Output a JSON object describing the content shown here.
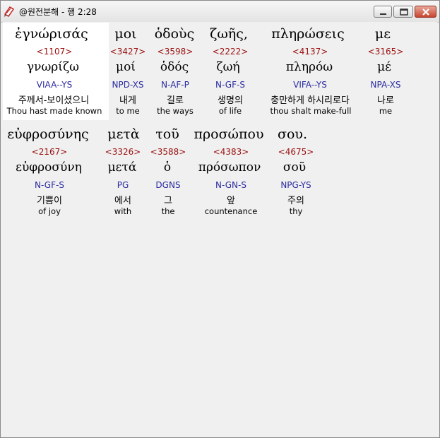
{
  "window": {
    "title": "@원전분해 - 행 2:28"
  },
  "lines": [
    {
      "words": [
        {
          "greek": "ἐγνώρισάς",
          "num": "<1107>",
          "lemma": "γνωρίζω",
          "morph": "VIAA--YS",
          "kor": "주께서-보이셨으니",
          "eng": "Thou hast made known",
          "selected": true
        },
        {
          "greek": "μοι",
          "num": "<3427>",
          "lemma": "μοί",
          "morph": "NPD-XS",
          "kor": "내게",
          "eng": "to me"
        },
        {
          "greek": "ὁδοὺς",
          "num": "<3598>",
          "lemma": "ὁδός",
          "morph": "N-AF-P",
          "kor": "길로",
          "eng": "the ways"
        },
        {
          "greek": "ζωῆς,",
          "num": "<2222>",
          "lemma": "ζωή",
          "morph": "N-GF-S",
          "kor": "생명의",
          "eng": "of life"
        },
        {
          "greek": "πληρώσεις",
          "num": "<4137>",
          "lemma": "πληρόω",
          "morph": "VIFA--YS",
          "kor": "충만하게 하시리로다",
          "eng": "thou shalt make-full"
        },
        {
          "greek": "με",
          "num": "<3165>",
          "lemma": "μέ",
          "morph": "NPA-XS",
          "kor": "나로",
          "eng": "me"
        }
      ]
    },
    {
      "words": [
        {
          "greek": "εὐφροσύνης",
          "num": "<2167>",
          "lemma": "εὐφροσύνη",
          "morph": "N-GF-S",
          "kor": "기쁨이",
          "eng": "of joy"
        },
        {
          "greek": "μετὰ",
          "num": "<3326>",
          "lemma": "μετά",
          "morph": "PG",
          "kor": "에서",
          "eng": "with"
        },
        {
          "greek": "τοῦ",
          "num": "<3588>",
          "lemma": "ὁ",
          "morph": "DGNS",
          "kor": "그",
          "eng": "the"
        },
        {
          "greek": "προσώπου",
          "num": "<4383>",
          "lemma": "πρόσωπον",
          "morph": "N-GN-S",
          "kor": "앞",
          "eng": "countenance"
        },
        {
          "greek": "σου.",
          "num": "<4675>",
          "lemma": "σοῦ",
          "morph": "NPG-YS",
          "kor": "주의",
          "eng": "thy"
        }
      ]
    }
  ]
}
